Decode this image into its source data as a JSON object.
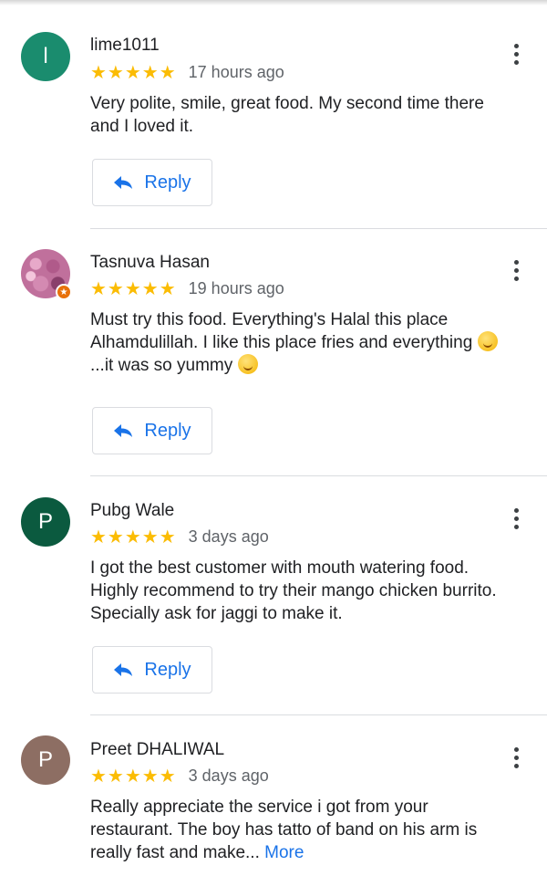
{
  "reviews": [
    {
      "avatar_letter": "l",
      "avatar_color": "#1a8c6e",
      "name": "lime1011",
      "stars": "★★★★★",
      "time": "17 hours ago",
      "text": "Very polite, smile, great food. My second time there and I loved it.",
      "reply_label": "Reply"
    },
    {
      "avatar_letter": "",
      "name": "Tasnuva Hasan",
      "stars": "★★★★★",
      "time": "19 hours ago",
      "text_line1": "Must try this food. Everything's Halal this place Alhamdulillah. I like this place fries and everything",
      "text_mid": "...it was so yummy",
      "reply_label": "Reply"
    },
    {
      "avatar_letter": "P",
      "avatar_color": "#0b5a3f",
      "name": "Pubg Wale",
      "stars": "★★★★★",
      "time": "3 days ago",
      "text": "I got the best customer with mouth watering food. Highly recommend to try their mango chicken burrito. Specially ask for jaggi to make it.",
      "reply_label": "Reply"
    },
    {
      "avatar_letter": "P",
      "avatar_color": "#8d6e63",
      "name": "Preet DHALIWAL",
      "stars": "★★★★★",
      "time": "3 days ago",
      "text": "Really appreciate the service i got from your restaurant. The boy has tatto of band on his arm is really fast and make...",
      "more_label": "More"
    }
  ],
  "colors": {
    "accent": "#1a73e8",
    "star": "#fbbc04",
    "divider": "#dadce0"
  },
  "icons": {
    "menu": "more-vert-icon",
    "reply": "reply-arrow-icon",
    "rating": "star-icon"
  }
}
